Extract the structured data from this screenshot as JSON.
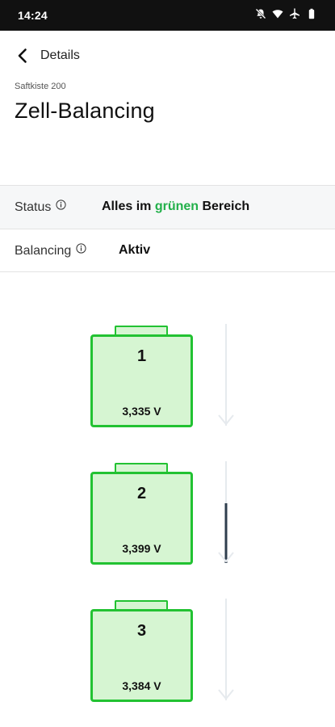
{
  "status_bar": {
    "time": "14:24",
    "icons": [
      "bell-off-icon",
      "wifi-icon",
      "airplane-icon",
      "battery-icon"
    ]
  },
  "nav": {
    "back_label": "Details"
  },
  "header": {
    "subtitle": "Saftkiste 200",
    "title": "Zell-Balancing"
  },
  "status_row": {
    "label": "Status",
    "value_prefix": "Alles im ",
    "value_highlight": "grünen",
    "value_suffix": " Bereich"
  },
  "balancing_row": {
    "label": "Balancing",
    "value": "Aktiv"
  },
  "cells": [
    {
      "number": "1",
      "voltage": "3,335 V",
      "balancing_level": 0
    },
    {
      "number": "2",
      "voltage": "3,399 V",
      "balancing_level": 0.6
    },
    {
      "number": "3",
      "voltage": "3,384 V",
      "balancing_level": 0
    }
  ],
  "colors": {
    "accent_green": "#22b04a",
    "cell_border": "#22c232",
    "cell_fill": "#d6f5d2",
    "flow_active": "#2f3e4e",
    "flow_idle": "#e6eaee"
  }
}
